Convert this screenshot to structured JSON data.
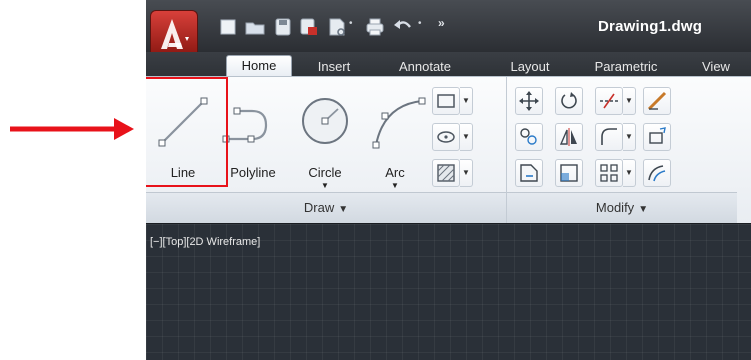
{
  "titlebar": {
    "document_title": "Drawing1.dwg",
    "app_button_icon": "autocad-logo-icon",
    "quick_access_icons": [
      "new-icon",
      "open-icon",
      "save-icon",
      "save-as-icon",
      "plot-preview-icon",
      "print-icon",
      "undo-icon",
      "more-icon"
    ]
  },
  "tabs": [
    {
      "label": "Home",
      "active": true
    },
    {
      "label": "Insert",
      "active": false
    },
    {
      "label": "Annotate",
      "active": false
    },
    {
      "label": "Layout",
      "active": false
    },
    {
      "label": "Parametric",
      "active": false
    },
    {
      "label": "View",
      "active": false
    }
  ],
  "draw_panel": {
    "title": "Draw",
    "tools": {
      "line": "Line",
      "polyline": "Polyline",
      "circle": "Circle",
      "arc": "Arc"
    }
  },
  "modify_panel": {
    "title": "Modify"
  },
  "viewport": {
    "label": "[−][Top][2D Wireframe]"
  },
  "colors": {
    "highlight": "#e8121a",
    "arrow": "#e8121a",
    "app_button": "#c8302a"
  }
}
